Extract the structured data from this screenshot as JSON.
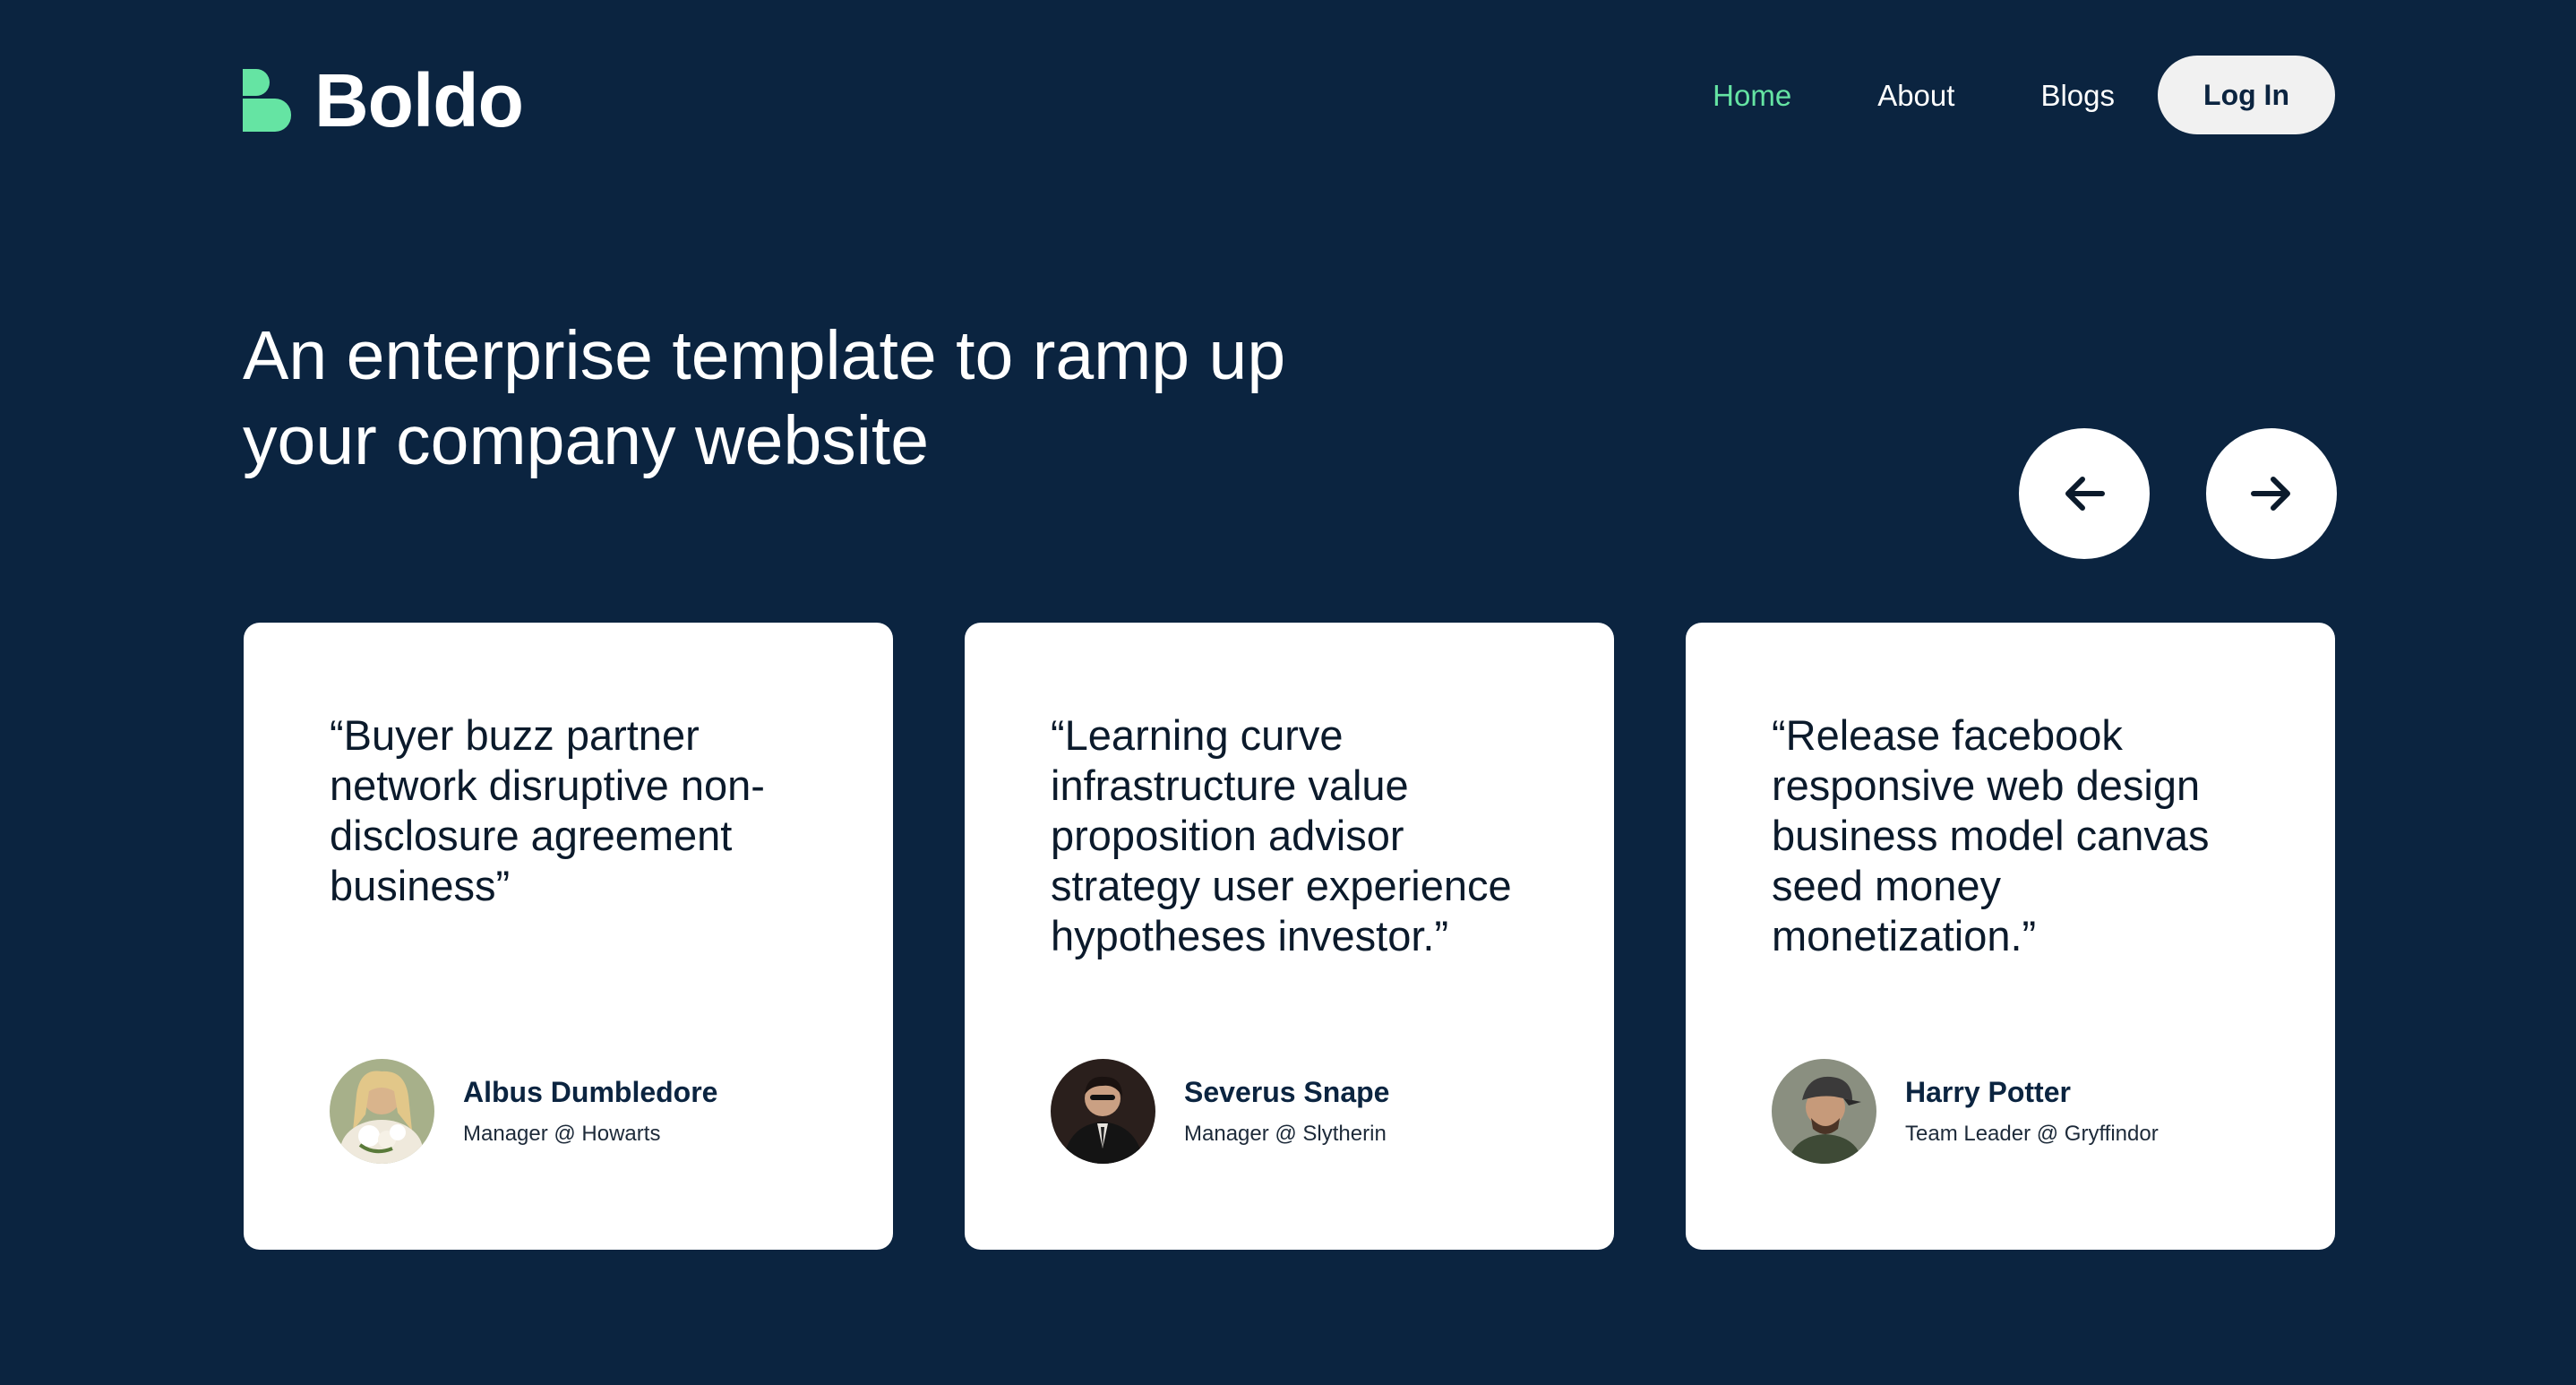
{
  "brand": {
    "name": "Boldo",
    "accent": "#65e4a3",
    "background": "#0b2440"
  },
  "nav": {
    "items": [
      {
        "label": "Home",
        "active": true
      },
      {
        "label": "About",
        "active": false
      },
      {
        "label": "Blogs",
        "active": false
      }
    ],
    "login_label": "Log In"
  },
  "hero": {
    "title_line1": "An enterprise template to ramp up",
    "title_line2": "your company website"
  },
  "carousel": {
    "prev_icon": "arrow-left-icon",
    "next_icon": "arrow-right-icon"
  },
  "testimonials": [
    {
      "quote": "“Buyer buzz partner network disruptive non-disclosure agreement business”",
      "name": "Albus Dumbledore",
      "role": "Manager @ Howarts"
    },
    {
      "quote": "“Learning curve infrastructure value proposition advisor strategy user experience hypotheses investor.”",
      "name": "Severus Snape",
      "role": "Manager @ Slytherin"
    },
    {
      "quote": "“Release facebook responsive web design business model canvas seed money monetization.”",
      "name": "Harry Potter",
      "role": "Team Leader @ Gryffindor"
    }
  ]
}
